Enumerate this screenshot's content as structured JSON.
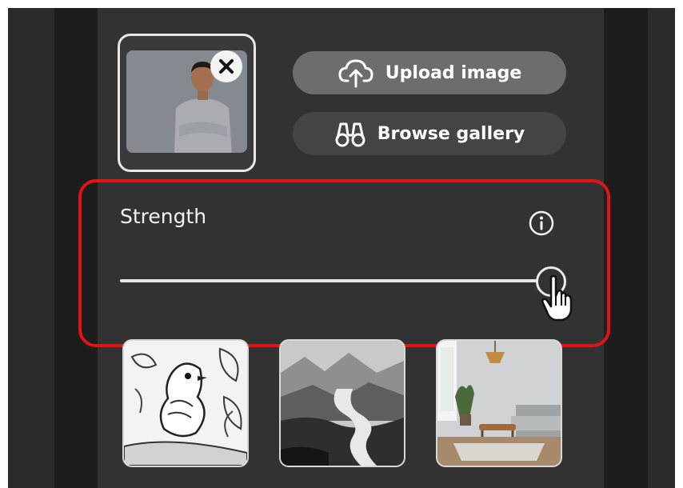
{
  "upload": {
    "label": "Upload image",
    "icon": "cloud-upload-icon"
  },
  "browse": {
    "label": "Browse gallery",
    "icon": "binoculars-icon"
  },
  "reference": {
    "remove_icon": "close-icon"
  },
  "strength": {
    "label": "Strength",
    "info_icon": "info-icon",
    "value": 1.0
  },
  "samples": [
    {
      "name": "bird-sketch-sample"
    },
    {
      "name": "misty-river-sample"
    },
    {
      "name": "living-room-sample"
    }
  ],
  "colors": {
    "highlight": "#e01414",
    "panel": "#323232",
    "upload_button": "#6d6d6d",
    "browse_button": "#444444"
  }
}
